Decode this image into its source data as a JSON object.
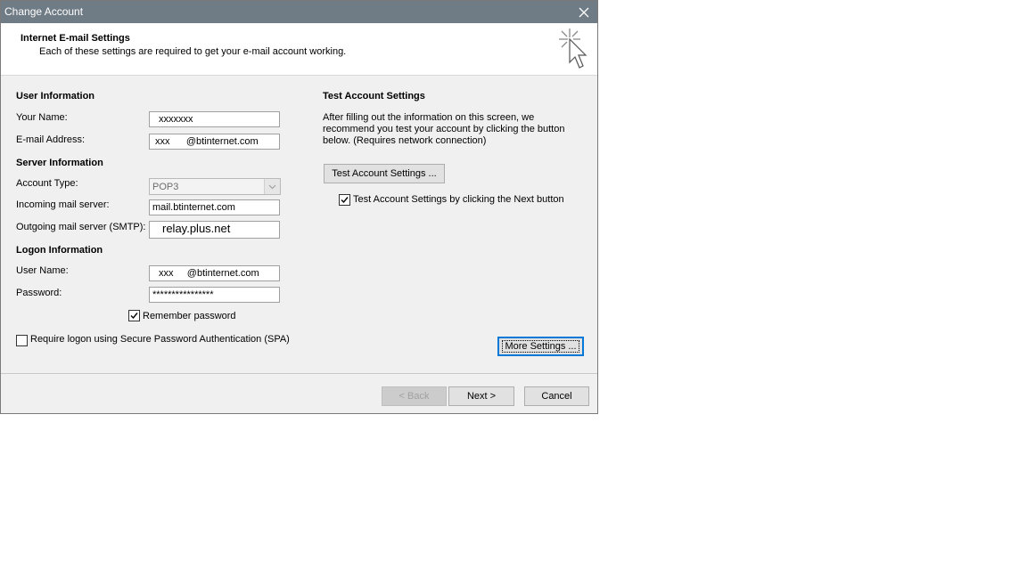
{
  "window": {
    "title": "Change Account"
  },
  "header": {
    "title": "Internet E-mail Settings",
    "subtitle": "Each of these settings are required to get your e-mail account working."
  },
  "user_info": {
    "heading": "User Information",
    "name_label": "Your Name:",
    "name_value": "xxxxxxx",
    "email_label": "E-mail Address:",
    "email_value": "xxx      @btinternet.com"
  },
  "server_info": {
    "heading": "Server Information",
    "account_type_label": "Account Type:",
    "account_type_value": "POP3",
    "incoming_label": "Incoming mail server:",
    "incoming_value": "mail.btinternet.com",
    "outgoing_label": "Outgoing mail server (SMTP):",
    "outgoing_value": "relay.plus.net"
  },
  "logon_info": {
    "heading": "Logon Information",
    "username_label": "User Name:",
    "username_value": "xxx     @btinternet.com",
    "password_label": "Password:",
    "password_value": "****************",
    "remember_label": "Remember password",
    "remember_checked": true,
    "spa_label": "Require logon using Secure Password Authentication (SPA)",
    "spa_checked": false
  },
  "test_settings": {
    "heading": "Test Account Settings",
    "description": "After filling out the information on this screen, we recommend you test your account by clicking the button below. (Requires network connection)",
    "button_label": "Test Account Settings ...",
    "next_check_label": "Test Account Settings by clicking the Next button",
    "next_check_checked": true
  },
  "buttons": {
    "more_settings": "More Settings ...",
    "back": "< Back",
    "next": "Next >",
    "cancel": "Cancel"
  },
  "icons": {
    "close": "close-icon",
    "header": "click-cursor-icon",
    "dropdown": "chevron-down-icon",
    "check": "checkmark-icon"
  }
}
